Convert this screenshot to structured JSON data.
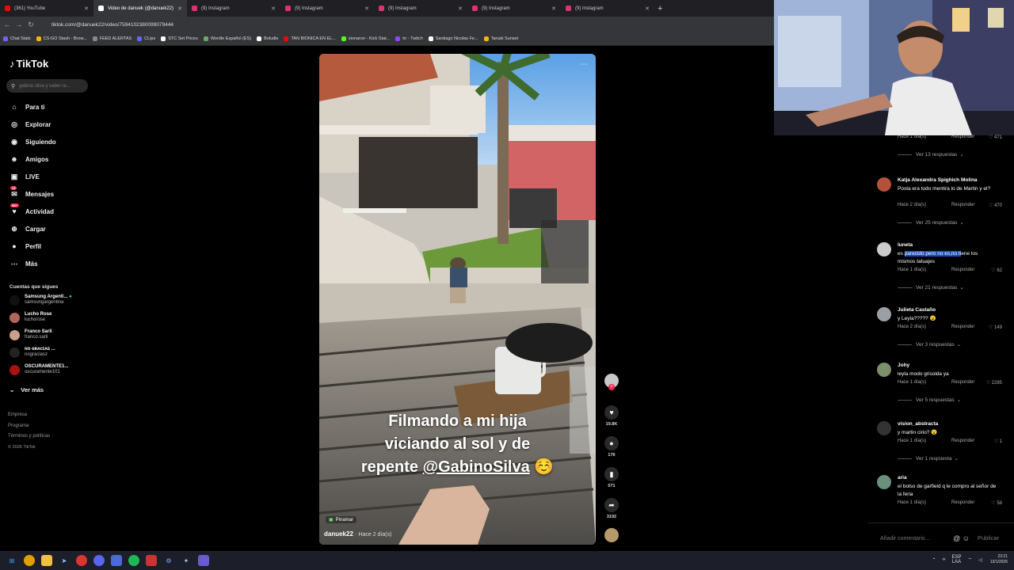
{
  "tabs": [
    {
      "label": "(361) YouTube",
      "color": "#ff0000",
      "active": false
    },
    {
      "label": "Video de danuek (@danuek22)",
      "color": "#ffffff",
      "active": true
    },
    {
      "label": "(9) Instagram",
      "color": "#e1306c",
      "active": false
    },
    {
      "label": "(9) Instagram",
      "color": "#e1306c",
      "active": false
    },
    {
      "label": "(9) Instagram",
      "color": "#e1306c",
      "active": false
    },
    {
      "label": "(9) Instagram",
      "color": "#e1306c",
      "active": false
    },
    {
      "label": "(9) Instagram",
      "color": "#e1306c",
      "active": false
    }
  ],
  "url": "tiktok.com/@danuek22/video/7594102380099079444",
  "bookmarks": [
    {
      "label": "Chat Stats",
      "color": "#7c5cff"
    },
    {
      "label": "CS:GO Stash - Brow...",
      "color": "#ffb300"
    },
    {
      "label": "FEED ALERTAS",
      "color": "#888888"
    },
    {
      "label": "CLips",
      "color": "#5b6bff"
    },
    {
      "label": "STC Set Prices",
      "color": "#ffffff"
    },
    {
      "label": "Wordle Español (ES)",
      "color": "#6aaa64"
    },
    {
      "label": "Boludle",
      "color": "#ffffff"
    },
    {
      "label": "TAN BIONICA EN EL...",
      "color": "#ff0000"
    },
    {
      "label": "sionaron - Kick Stat...",
      "color": "#53fc18"
    },
    {
      "label": "trr - Twitch",
      "color": "#9146ff"
    },
    {
      "label": "Santiago Nicolas Fe...",
      "color": "#ffffff"
    },
    {
      "label": "Tanuki Sunset",
      "color": "#ffb300"
    }
  ],
  "sidebar": {
    "logo": "TikTok",
    "search_placeholder": "gabino silva y valen ra...",
    "nav": [
      {
        "label": "Para ti",
        "icon": "home-icon"
      },
      {
        "label": "Explorar",
        "icon": "compass-icon"
      },
      {
        "label": "Siguiendo",
        "icon": "following-icon"
      },
      {
        "label": "Amigos",
        "icon": "friends-icon"
      },
      {
        "label": "LIVE",
        "icon": "live-icon"
      },
      {
        "label": "Mensajes",
        "icon": "messages-icon",
        "badge": "13"
      },
      {
        "label": "Actividad",
        "icon": "activity-icon",
        "badge": "99+"
      },
      {
        "label": "Cargar",
        "icon": "upload-icon"
      },
      {
        "label": "Perfil",
        "icon": "profile-icon"
      },
      {
        "label": "Más",
        "icon": "more-icon"
      }
    ],
    "following_title": "Cuentas que sigues",
    "following": [
      {
        "name": "Samsung Argenti...",
        "handle": "samsungargentina",
        "color": "#111111",
        "verified": true
      },
      {
        "name": "Lucho Rose",
        "handle": "luchorose",
        "color": "#b0645a"
      },
      {
        "name": "Franco Sarli",
        "handle": "franco.sarli",
        "color": "#c9a08a"
      },
      {
        "name": "ɴᴏ ɢʀᴀᴄɪᴀꜱ ...",
        "handle": "nograciasz",
        "color": "#222222"
      },
      {
        "name": "OSCURAMENTE1...",
        "handle": "oscuramente101",
        "color": "#aa1111"
      }
    ],
    "ver_mas": "Ver más",
    "footer": [
      "Empresa",
      "Programa",
      "Términos y políticas"
    ],
    "copyright": "© 2026 TikTok"
  },
  "video": {
    "caption_line1": "Filmando a mi hija",
    "caption_line2": "viciando al sol y de",
    "caption_line3_pre": "repente ",
    "caption_mention": "@GabinoSilva",
    "caption_emoji": "☺️",
    "location": "Pinamar",
    "author": "danuek22",
    "time": "· Hace 2 día(s)"
  },
  "actions": [
    {
      "icon": "heart-icon",
      "count": "19.8K"
    },
    {
      "icon": "comment-icon",
      "count": "176"
    },
    {
      "icon": "bookmark-icon",
      "count": "571"
    },
    {
      "icon": "share-icon",
      "count": "3192"
    }
  ],
  "comments": [
    {
      "name": "",
      "text": "",
      "meta": "Hace 1 día(s)",
      "respond": "Responder",
      "likes": "471",
      "replies": "Ver 13 respuestas",
      "avatar": "#444444"
    },
    {
      "name": "Katja Alexandra Spighich Molina",
      "text": "Posta era todo mentira lo de Martin y el?",
      "meta": "Hace 2 día(s)",
      "respond": "Responder",
      "likes": "470",
      "replies": "Ver 25 respuestas",
      "avatar": "#b5503c"
    },
    {
      "name": "luneta",
      "text_hl": "parecido pero no es,no ti",
      "text_pre": "es ",
      "text_post": "ene los mismos tatuajes",
      "meta": "Hace 1 día(s)",
      "respond": "Responder",
      "likes": "62",
      "replies": "Ver 21 respuestas",
      "avatar": "#cccccc"
    },
    {
      "name": "Julieta Castaño",
      "text": "y Leyla????? 😮",
      "meta": "Hace 2 día(s)",
      "respond": "Responder",
      "likes": "149",
      "replies": "Ver 3 respuestas",
      "avatar": "#9aa0a6"
    },
    {
      "name": "Johy",
      "text": "leyla modo grisolda ya",
      "meta": "Hace 1 día(s)",
      "respond": "Responder",
      "likes": "2285",
      "replies": "Ver 5 respuestas",
      "avatar": "#7a8f6a"
    },
    {
      "name": "vision_abstracta",
      "text": "y martin cirio? 😮",
      "meta": "Hace 1 día(s)",
      "respond": "Responder",
      "likes": "1",
      "replies": "Ver 1 respuesta",
      "avatar": "#333333"
    },
    {
      "name": "aria",
      "text": "el bolso de garfield q le compro al señor de la feria",
      "meta": "Hace 1 día(s)",
      "respond": "Responder",
      "likes": "58",
      "replies": "",
      "avatar": "#6a8f7a"
    }
  ],
  "add_comment_placeholder": "Añadir comentario...",
  "publish_label": "Publicar",
  "tray": {
    "lang": "ESP",
    "lang2": "LAA",
    "time": "23:21",
    "date": "13/1/2026"
  }
}
